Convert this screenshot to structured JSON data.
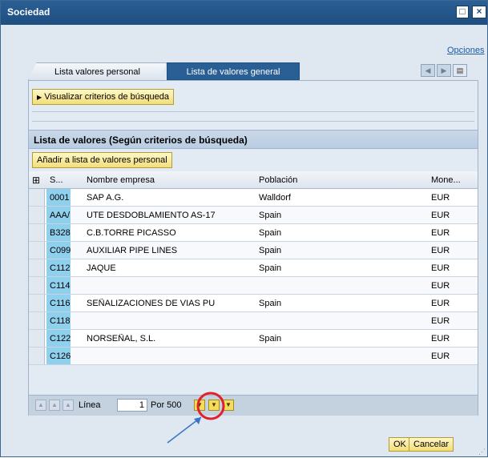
{
  "window": {
    "title": "Sociedad"
  },
  "links": {
    "options": "Opciones"
  },
  "tabs": [
    {
      "label": "Lista valores personal"
    },
    {
      "label": "Lista de valores general"
    }
  ],
  "search": {
    "toggle_label": "Visualizar criterios de búsqueda"
  },
  "section": {
    "title": "Lista de valores (Según criterios de búsqueda)"
  },
  "actions": {
    "add_personal": "Añadir a lista de valores personal"
  },
  "table": {
    "headers": {
      "key": "S...",
      "name": "Nombre empresa",
      "city": "Población",
      "currency": "Mone..."
    },
    "rows": [
      {
        "key": "0001",
        "name": "SAP A.G.",
        "city": "Walldorf",
        "currency": "EUR"
      },
      {
        "key": "AAA/",
        "name": "UTE DESDOBLAMIENTO AS-17",
        "city": "Spain",
        "currency": "EUR"
      },
      {
        "key": "B328",
        "name": "C.B.TORRE PICASSO",
        "city": "Spain",
        "currency": "EUR"
      },
      {
        "key": "C099",
        "name": "AUXILIAR PIPE LINES",
        "city": "Spain",
        "currency": "EUR"
      },
      {
        "key": "C112",
        "name": "JAQUE",
        "city": "Spain",
        "currency": "EUR"
      },
      {
        "key": "C114",
        "name": "",
        "city": "",
        "currency": "EUR"
      },
      {
        "key": "C116",
        "name": "SEÑALIZACIONES DE VIAS PU",
        "city": "Spain",
        "currency": "EUR"
      },
      {
        "key": "C118",
        "name": "",
        "city": "",
        "currency": "EUR"
      },
      {
        "key": "C122",
        "name": "NORSEÑAL, S.L.",
        "city": "Spain",
        "currency": "EUR"
      },
      {
        "key": "C126",
        "name": "",
        "city": "",
        "currency": "EUR"
      }
    ]
  },
  "pager": {
    "line_label": "Línea",
    "line_value": "1",
    "per_label": "Por 500"
  },
  "buttons": {
    "ok": "OK",
    "cancel": "Cancelar"
  },
  "colors": {
    "title_bar": "#1f4e80",
    "key_cell": "#8fd0ed",
    "highlight_circle": "#e0202a",
    "arrow": "#3b74c7"
  }
}
